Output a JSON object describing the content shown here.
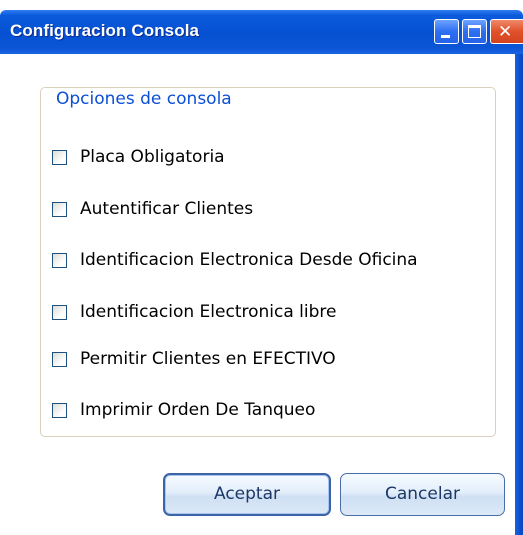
{
  "window": {
    "title": "Configuracion Consola",
    "controls": {
      "minimize": "minimize-icon",
      "maximize": "maximize-icon",
      "close": "close-icon"
    },
    "accent_color": "#0a54d6",
    "close_color": "#e0502a"
  },
  "group": {
    "legend": "Opciones de consola",
    "options": [
      {
        "label": "Placa Obligatoria",
        "checked": false
      },
      {
        "label": "Autentificar Clientes",
        "checked": false
      },
      {
        "label": "Identificacion Electronica Desde Oficina",
        "checked": false
      },
      {
        "label": "Identificacion Electronica libre",
        "checked": false
      },
      {
        "label": "Permitir Clientes en EFECTIVO",
        "checked": false
      },
      {
        "label": "Imprimir Orden De Tanqueo",
        "checked": false
      }
    ],
    "legend_color": "#0b4fd6"
  },
  "buttons": {
    "accept_label": "Aceptar",
    "cancel_label": "Cancelar"
  }
}
